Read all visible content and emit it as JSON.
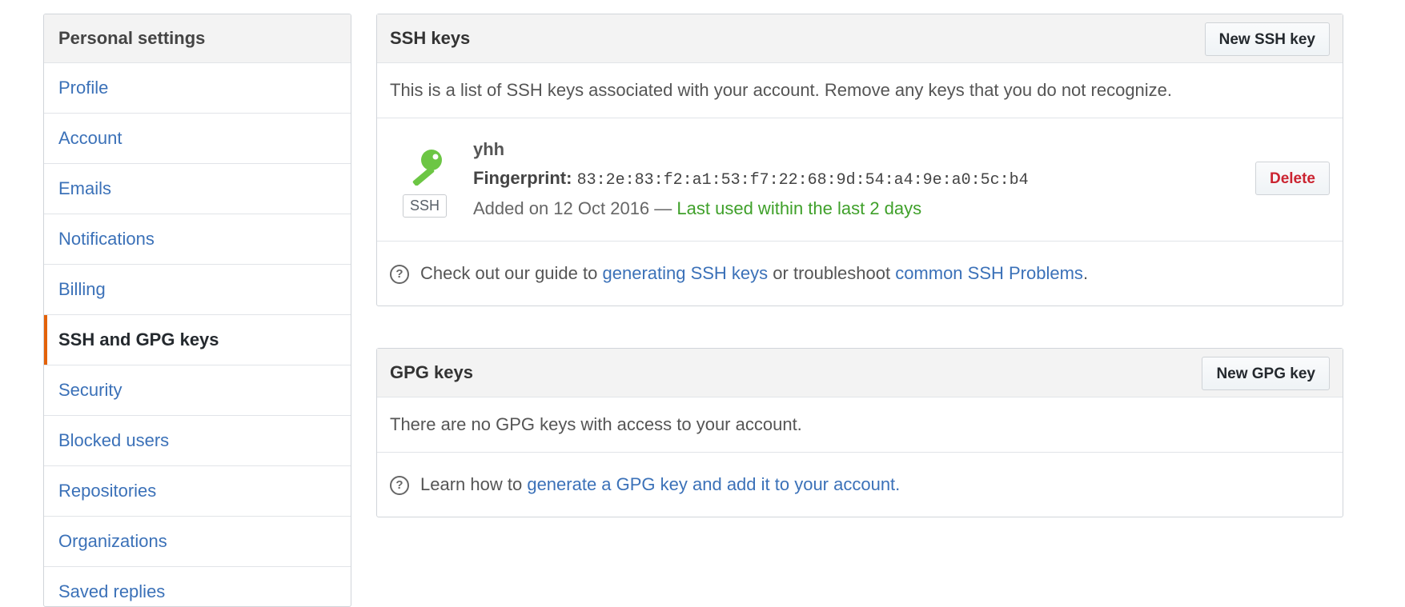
{
  "sidebar": {
    "header": "Personal settings",
    "items": [
      {
        "label": "Profile"
      },
      {
        "label": "Account"
      },
      {
        "label": "Emails"
      },
      {
        "label": "Notifications"
      },
      {
        "label": "Billing"
      },
      {
        "label": "SSH and GPG keys",
        "selected": true
      },
      {
        "label": "Security"
      },
      {
        "label": "Blocked users"
      },
      {
        "label": "Repositories"
      },
      {
        "label": "Organizations"
      },
      {
        "label": "Saved replies"
      }
    ]
  },
  "ssh": {
    "title": "SSH keys",
    "new_button": "New SSH key",
    "description": "This is a list of SSH keys associated with your account. Remove any keys that you do not recognize.",
    "key": {
      "name": "yhh",
      "badge": "SSH",
      "fingerprint_label": "Fingerprint:",
      "fingerprint": "83:2e:83:f2:a1:53:f7:22:68:9d:54:a4:9e:a0:5c:b4",
      "added": "Added on 12 Oct 2016 —",
      "last_used": "Last used within the last 2 days",
      "delete_button": "Delete"
    },
    "help": {
      "prefix": "Check out our guide to",
      "link1": "generating SSH keys",
      "middle": "or troubleshoot",
      "link2": "common SSH Problems",
      "suffix": "."
    }
  },
  "gpg": {
    "title": "GPG keys",
    "new_button": "New GPG key",
    "empty": "There are no GPG keys with access to your account.",
    "help": {
      "prefix": "Learn how to",
      "link": "generate a GPG key and add it to your account."
    }
  },
  "colors": {
    "accent": "#e36209",
    "link": "#3b71b8",
    "key_icon": "#6cc644",
    "last_used": "#3fa02a",
    "danger": "#cb2431"
  }
}
